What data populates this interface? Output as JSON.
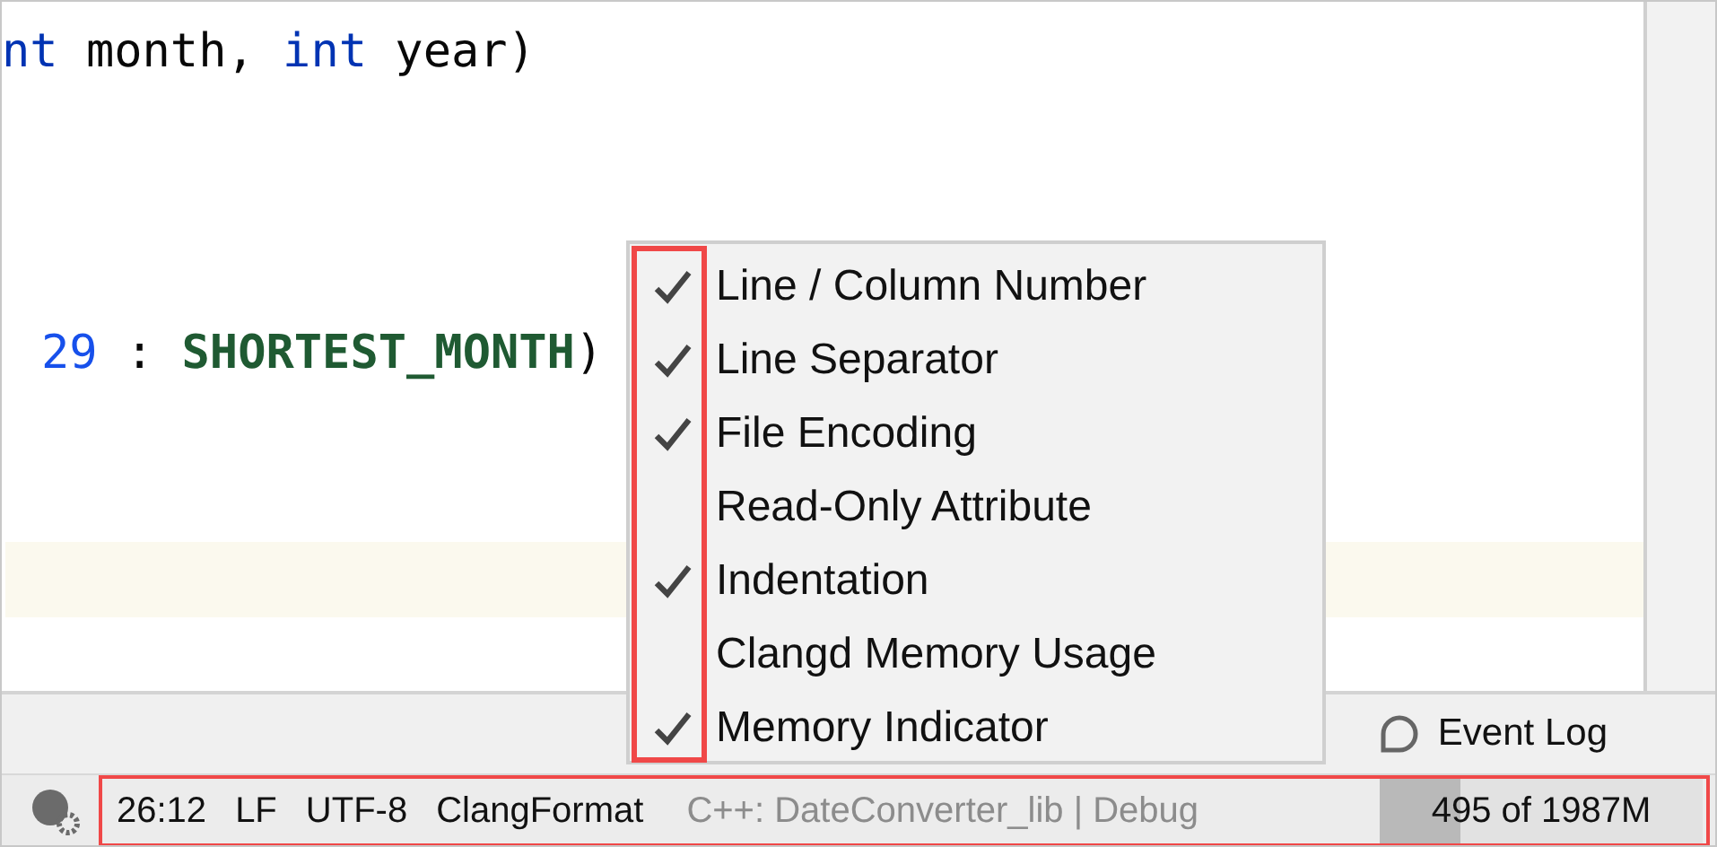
{
  "editor": {
    "code_lines": [
      {
        "tokens": [
          {
            "kind": "keyword",
            "text": "nt"
          },
          {
            "kind": "plain",
            "text": " month, "
          },
          {
            "kind": "keyword",
            "text": "int"
          },
          {
            "kind": "plain",
            "text": " year)"
          }
        ]
      },
      {
        "tokens": [
          {
            "kind": "number",
            "text": "29"
          },
          {
            "kind": "plain",
            "text": " : "
          },
          {
            "kind": "constant",
            "text": "SHORTEST_MONTH"
          },
          {
            "kind": "plain",
            "text": ")"
          }
        ]
      }
    ]
  },
  "context_menu": {
    "items": [
      {
        "label": "Line / Column Number",
        "checked": true
      },
      {
        "label": "Line Separator",
        "checked": true
      },
      {
        "label": "File Encoding",
        "checked": true
      },
      {
        "label": "Read-Only Attribute",
        "checked": false
      },
      {
        "label": "Indentation",
        "checked": true
      },
      {
        "label": "Clangd Memory Usage",
        "checked": false
      },
      {
        "label": "Memory Indicator",
        "checked": true
      }
    ]
  },
  "tool_bar": {
    "event_log": "Event Log"
  },
  "status_bar": {
    "items": [
      {
        "kind": "widget",
        "text": "26:12"
      },
      {
        "kind": "widget",
        "text": "LF"
      },
      {
        "kind": "widget",
        "text": "UTF-8"
      },
      {
        "kind": "widget",
        "text": "ClangFormat"
      },
      {
        "kind": "context",
        "text": "C++: DateConverter_lib | Debug"
      }
    ],
    "memory": {
      "text": "495 of 1987M",
      "level": 0.25
    }
  }
}
